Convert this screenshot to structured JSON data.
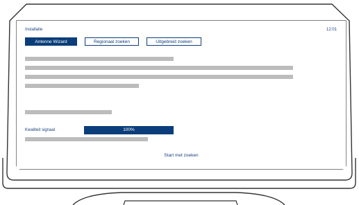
{
  "screen": {
    "title": "Installatie",
    "clock": "12:01"
  },
  "tabs": [
    {
      "label": "Antenne Wizard",
      "active": true
    },
    {
      "label": "Regionaal zoeken",
      "active": false
    },
    {
      "label": "Uitgebreid zoeken",
      "active": false
    }
  ],
  "signal": {
    "label": "Kwaliteit signaal",
    "value_text": "100%",
    "level_percent": 100
  },
  "actions": {
    "start_search": "Start met zoeken"
  },
  "colors": {
    "accent": "#0a3d7a",
    "placeholder_line": "#bcbcbc",
    "text": "#1a3f7a"
  }
}
